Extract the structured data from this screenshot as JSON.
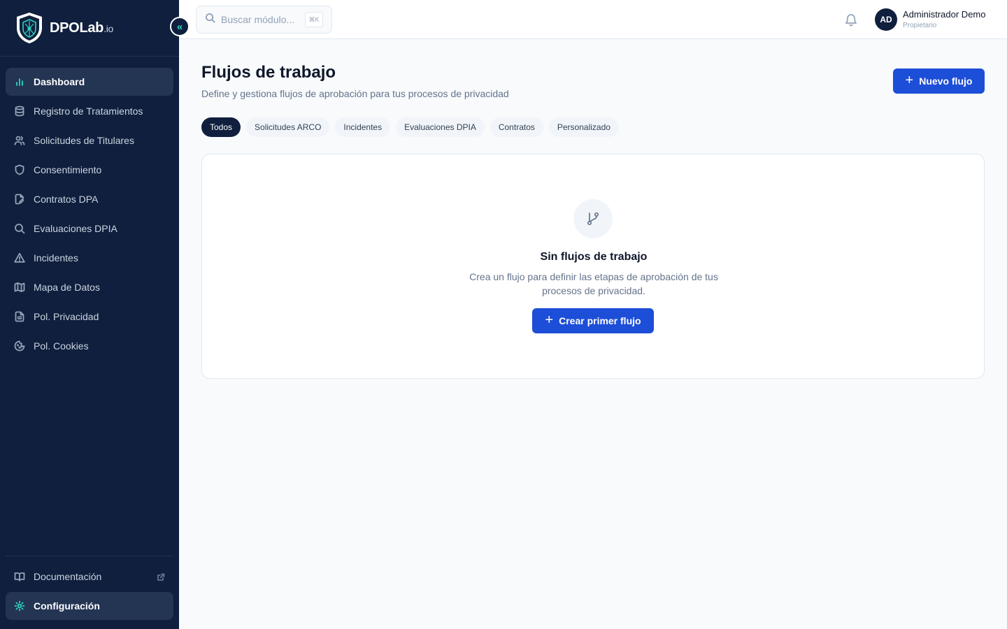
{
  "brand": {
    "name": "DPOLab",
    "suffix": ".io",
    "logo_icon": "shield-logo-icon",
    "accent_color": "#2dd4bf"
  },
  "sidebar": {
    "collapse_icon": "chevrons-left-icon",
    "items": [
      {
        "label": "Dashboard",
        "icon": "bar-chart-icon",
        "active": true
      },
      {
        "label": "Registro de Tratamientos",
        "icon": "database-icon",
        "active": false
      },
      {
        "label": "Solicitudes de Titulares",
        "icon": "users-icon",
        "active": false
      },
      {
        "label": "Consentimiento",
        "icon": "shield-icon",
        "active": false
      },
      {
        "label": "Contratos DPA",
        "icon": "file-edit-icon",
        "active": false
      },
      {
        "label": "Evaluaciones DPIA",
        "icon": "search-icon",
        "active": false
      },
      {
        "label": "Incidentes",
        "icon": "alert-triangle-icon",
        "active": false
      },
      {
        "label": "Mapa de Datos",
        "icon": "map-icon",
        "active": false
      },
      {
        "label": "Pol. Privacidad",
        "icon": "file-text-icon",
        "active": false
      },
      {
        "label": "Pol. Cookies",
        "icon": "cookie-icon",
        "active": false
      }
    ],
    "bottom": [
      {
        "label": "Documentación",
        "icon": "book-open-icon",
        "external": true
      },
      {
        "label": "Configuración",
        "icon": "settings-icon",
        "active": true
      }
    ]
  },
  "topbar": {
    "search": {
      "placeholder": "Buscar módulo...",
      "shortcut": "⌘K"
    },
    "notifications_icon": "bell-icon",
    "user": {
      "initials": "AD",
      "name": "Administrador Demo",
      "role": "Propietario"
    }
  },
  "main": {
    "title": "Flujos de trabajo",
    "subtitle": "Define y gestiona flujos de aprobación para tus procesos de privacidad",
    "new_button": "Nuevo flujo",
    "tabs": [
      {
        "label": "Todos",
        "active": true
      },
      {
        "label": "Solicitudes ARCO",
        "active": false
      },
      {
        "label": "Incidentes",
        "active": false
      },
      {
        "label": "Evaluaciones DPIA",
        "active": false
      },
      {
        "label": "Contratos",
        "active": false
      },
      {
        "label": "Personalizado",
        "active": false
      }
    ],
    "empty_state": {
      "icon": "git-branch-icon",
      "title": "Sin flujos de trabajo",
      "description": "Crea un flujo para definir las etapas de aprobación de tus procesos de privacidad.",
      "button": "Crear primer flujo"
    }
  },
  "colors": {
    "sidebar_bg": "#0f1f3d",
    "primary": "#1d4ed8",
    "page_bg": "#f8fafc"
  }
}
